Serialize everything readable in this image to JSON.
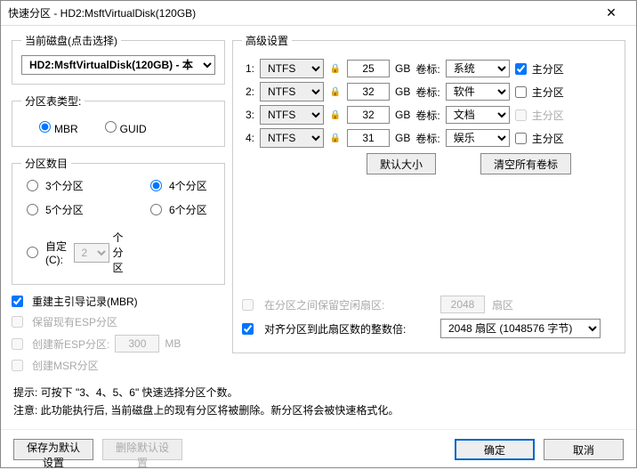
{
  "window": {
    "title": "快速分区 - HD2:MsftVirtualDisk(120GB)",
    "close": "✕"
  },
  "disk": {
    "legend": "当前磁盘(点击选择)",
    "value": "HD2:MsftVirtualDisk(120GB) - 本"
  },
  "tableType": {
    "legend": "分区表类型:",
    "mbr": "MBR",
    "guid": "GUID"
  },
  "count": {
    "legend": "分区数目",
    "opts": [
      "3个分区",
      "4个分区",
      "5个分区",
      "6个分区"
    ],
    "custom": "自定(C):",
    "customVal": "2",
    "customUnit": "个分区"
  },
  "mbrOpts": {
    "rebuild": "重建主引导记录(MBR)",
    "keepEsp": "保留现有ESP分区",
    "newEsp": "创建新ESP分区:",
    "newEspVal": "300",
    "mb": "MB",
    "msr": "创建MSR分区"
  },
  "adv": {
    "legend": "高级设置",
    "gbLabel": "GB",
    "volLabel": "卷标:",
    "primLabel": "主分区",
    "rows": [
      {
        "idx": "1:",
        "fs": "NTFS",
        "size": "25",
        "vol": "系统",
        "primChecked": true,
        "primEnabled": true
      },
      {
        "idx": "2:",
        "fs": "NTFS",
        "size": "32",
        "vol": "软件",
        "primChecked": false,
        "primEnabled": true
      },
      {
        "idx": "3:",
        "fs": "NTFS",
        "size": "32",
        "vol": "文档",
        "primChecked": false,
        "primEnabled": false
      },
      {
        "idx": "4:",
        "fs": "NTFS",
        "size": "31",
        "vol": "娱乐",
        "primChecked": false,
        "primEnabled": true
      }
    ],
    "btnDefault": "默认大小",
    "btnClear": "清空所有卷标",
    "gapLabel": "在分区之间保留空闲扇区:",
    "gapVal": "2048",
    "gapUnit": "扇区",
    "alignLabel": "对齐分区到此扇区数的整数倍:",
    "alignVal": "2048 扇区 (1048576 字节)"
  },
  "hints": {
    "h1": "提示: 可按下 \"3、4、5、6\" 快速选择分区个数。",
    "h2": "注意: 此功能执行后, 当前磁盘上的现有分区将被删除。新分区将会被快速格式化。"
  },
  "footer": {
    "saveDefault": "保存为默认设置",
    "delDefault": "删除默认设置",
    "ok": "确定",
    "cancel": "取消"
  }
}
